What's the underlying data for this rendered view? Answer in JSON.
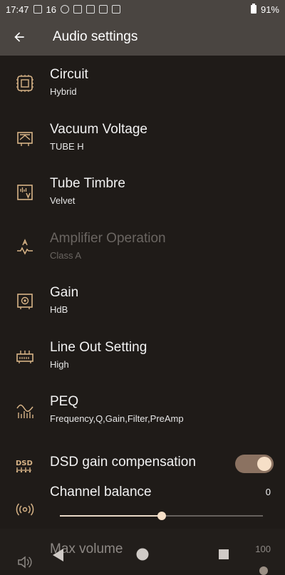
{
  "status_bar": {
    "time": "17:47",
    "notif_count": "16",
    "battery": "91%"
  },
  "header": {
    "title": "Audio settings",
    "back_icon": "arrow-left-icon"
  },
  "settings": [
    {
      "label": "Circuit",
      "value": "Hybrid",
      "icon": "circuit-chip-icon",
      "enabled": true
    },
    {
      "label": "Vacuum Voltage",
      "value": "TUBE H",
      "icon": "vacuum-tube-icon",
      "enabled": true
    },
    {
      "label": "Tube Timbre",
      "value": "Velvet",
      "icon": "timbre-wave-icon",
      "enabled": true
    },
    {
      "label": "Amplifier Operation",
      "value": "Class A",
      "icon": "amplifier-icon",
      "enabled": false
    },
    {
      "label": "Gain",
      "value": "HdB",
      "icon": "gain-icon",
      "enabled": true
    },
    {
      "label": "Line Out Setting",
      "value": "High",
      "icon": "line-out-icon",
      "enabled": true
    },
    {
      "label": "PEQ",
      "value": "Frequency,Q,Gain,Filter,PreAmp",
      "icon": "peq-icon",
      "enabled": true
    }
  ],
  "dsd": {
    "label": "DSD gain compensation",
    "icon": "dsd-icon",
    "enabled": true
  },
  "balance": {
    "label": "Channel balance",
    "value": "0",
    "icon": "balance-icon",
    "position": 0.5
  },
  "max_volume": {
    "label": "Max volume",
    "value": "100",
    "icon": "volume-icon",
    "position": 1.0
  },
  "colors": {
    "accent": "#f6dfc7",
    "icon_gold": "#d8b487",
    "header_bg": "#4a4541",
    "body_bg": "#1f1b18"
  }
}
